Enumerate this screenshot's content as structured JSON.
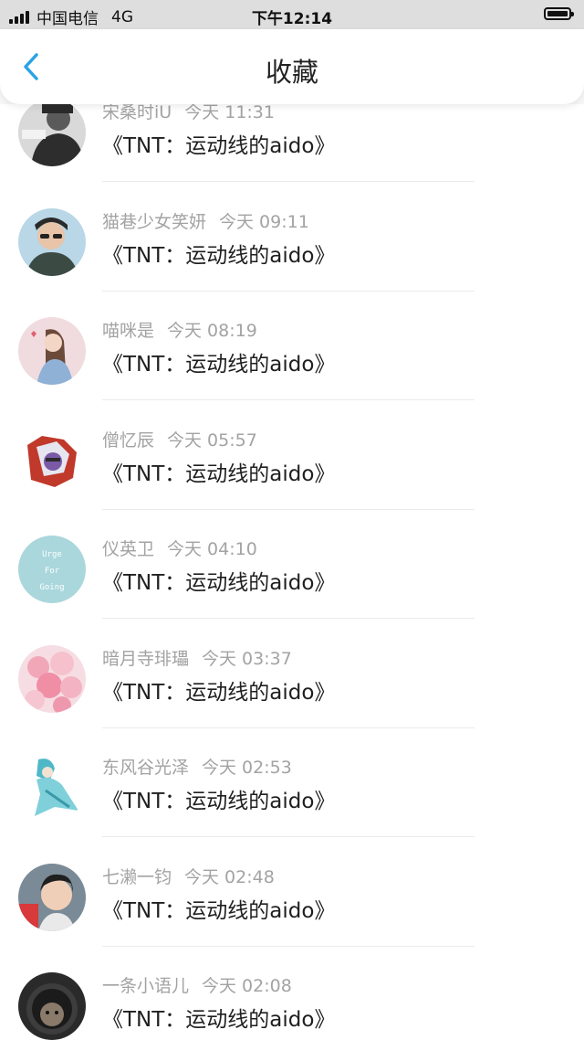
{
  "status_bar": {
    "carrier": "中国电信",
    "network": "4G",
    "time": "下午12:14"
  },
  "nav": {
    "title": "收藏",
    "back_icon": "chevron-left-icon",
    "accent_color": "#2aa3e6"
  },
  "items": [
    {
      "name": "宋桑时iU",
      "time": "今天 11:31",
      "message": "《TNT：运动线的aido》"
    },
    {
      "name": "猫巷少女笑妍",
      "time": "今天 09:11",
      "message": "《TNT：运动线的aido》"
    },
    {
      "name": "喵咪是",
      "time": "今天 08:19",
      "message": "《TNT：运动线的aido》"
    },
    {
      "name": "僧忆辰",
      "time": "今天 05:57",
      "message": "《TNT：运动线的aido》"
    },
    {
      "name": "仪英卫",
      "time": "今天 04:10",
      "message": "《TNT：运动线的aido》",
      "avatar_text": [
        "Urge",
        "For",
        "Going"
      ]
    },
    {
      "name": "暗月寺琲瓃",
      "time": "今天 03:37",
      "message": "《TNT：运动线的aido》"
    },
    {
      "name": "东风谷光泽",
      "time": "今天 02:53",
      "message": "《TNT：运动线的aido》"
    },
    {
      "name": "七濑一钧",
      "time": "今天 02:48",
      "message": "《TNT：运动线的aido》"
    },
    {
      "name": "一条小语儿",
      "time": "今天 02:08",
      "message": "《TNT：运动线的aido》"
    }
  ]
}
